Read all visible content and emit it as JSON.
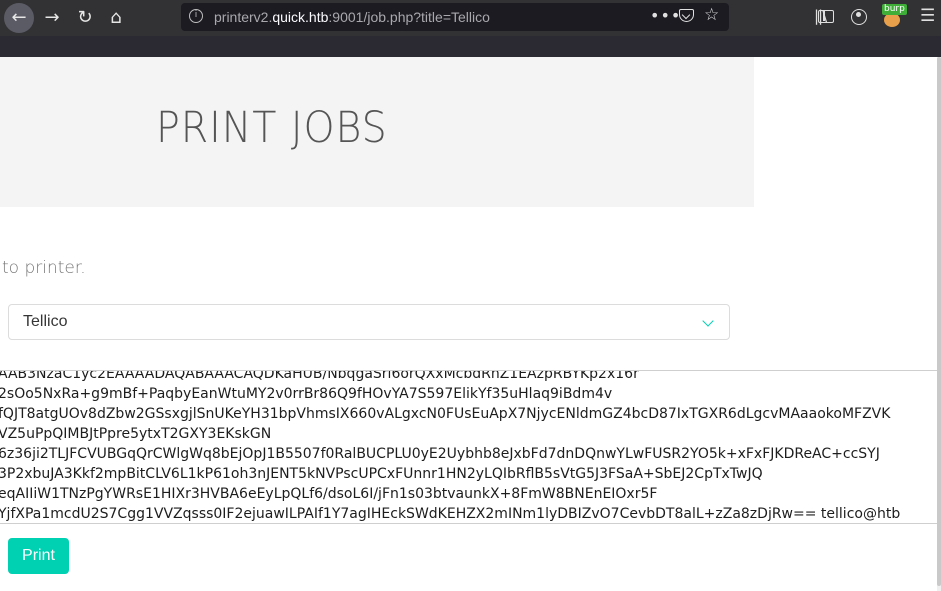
{
  "browser": {
    "url_prefix": "printerv2.",
    "url_domain": "quick.htb",
    "url_rest": ":9001/job.php?title=Tellico",
    "more_icon": "ellipsis-icon",
    "extension_badge": "burp"
  },
  "page": {
    "title": "PRINT JOBS",
    "instruction": "to printer.",
    "printer_select": {
      "selected": "Tellico"
    },
    "key_lines": [
      "AAB3NzaC1yc2EAAAADAQABAAACAQDKaHUB/NbqgaSrl6orQXxMcbdRnZ1EAzpRBYKp2x16r",
      "2sOo5NxRa+g9mBf+PaqbyEanWtuMY2v0rrBr86Q9fHOvYA7S597ElikYf35uHlaq9iBdm4v",
      "fQJT8atgUOv8dZbw2GSsxgjlSnUKeYH31bpVhmsIX660vALgxcN0FUsEuApX7NjycENldmGZ4bcD87IxTGXR6dLgcvMAaaokoMFZVK",
      "VZ5uPpQIMBJtPpre5ytxT2GXY3EKskGN",
      "6z36ji2TLJFCVUBGqQrCWlgWq8bEjOpJ1B5507f0RalBUCPLU0yE2Uybhb8eJxbFd7dnDQnwYLwFUSR2YO5k+xFxFJKDReAC+ccSYJ",
      "3P2xbuJA3Kkf2mpBitCLV6L1kP61oh3nJENT5kNVPscUPCxFUnnr1HN2yLQIbRflB5sVtG5J3FSaA+SbEJ2CpTxTwJQ",
      "eqAIIiW1TNzPgYWRsE1HIXr3HVBA6eEyLpQLf6/dsoL6I/jFn1s03btvaunkX+8FmW8BNEnEIOxr5F",
      "YjfXPa1mcdU2S7Cgg1VVZqsss0IF2ejuawILPAIf1Y7agIHEckSWdKEHZX2mINm1lyDBIZvO7CevbDT8alL+zZa8zDjRw== tellico@htb"
    ],
    "print_button": "Print"
  },
  "colors": {
    "accent": "#00d1b2",
    "toolbar": "#323234",
    "header_bg": "#f4f4f4"
  }
}
